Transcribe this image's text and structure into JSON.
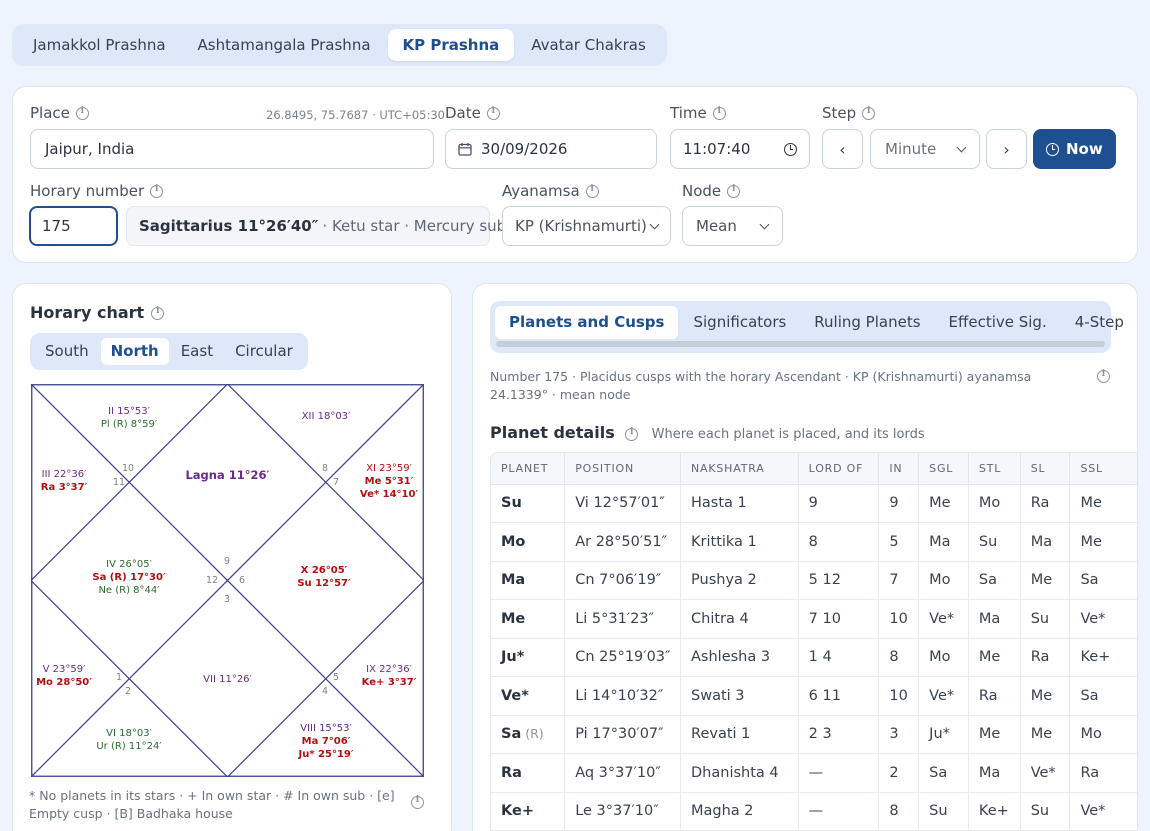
{
  "top_tabs": [
    "Jamakkol Prashna",
    "Ashtamangala Prashna",
    "KP Prashna",
    "Avatar Chakras"
  ],
  "form": {
    "place_label": "Place",
    "place_value": "Jaipur, India",
    "coords": "26.8495, 75.7687 · UTC+05:30",
    "date_label": "Date",
    "date_value": "30/09/2026",
    "time_label": "Time",
    "time_value": "11:07:40",
    "step_label": "Step",
    "step_value": "Minute",
    "prev_btn": "‹",
    "next_btn": "›",
    "now_btn": "Now",
    "horary_label": "Horary number",
    "horary_value": "175",
    "horary_info_main": "Sagittarius 11°26′40″",
    "horary_info_rest": " · Ketu star · Mercury sub",
    "ayanamsa_label": "Ayanamsa",
    "ayanamsa_value": "KP (Krishnamurti)",
    "node_label": "Node",
    "node_value": "Mean"
  },
  "chart": {
    "title": "Horary chart",
    "styles": [
      "South",
      "North",
      "East",
      "Circular"
    ],
    "active_style": "North",
    "houses": {
      "h1": {
        "lines": [
          "Lagna 11°26′"
        ]
      },
      "h2": {
        "lines": [
          "II 15°53′",
          "Pl (R) 8°59′"
        ]
      },
      "h3": {
        "lines": [
          "III 22°36′",
          "Ra 3°37′"
        ]
      },
      "h4": {
        "lines": [
          "IV 26°05′",
          "Sa (R) 17°30′",
          "Ne (R) 8°44′"
        ]
      },
      "h5": {
        "lines": [
          "V 23°59′",
          "Mo 28°50′"
        ]
      },
      "h6": {
        "lines": [
          "VI 18°03′",
          "Ur (R) 11°24′"
        ]
      },
      "h7": {
        "lines": [
          "VII 11°26′"
        ]
      },
      "h8": {
        "lines": [
          "VIII 15°53′",
          "Ma 7°06′",
          "Ju* 25°19′"
        ]
      },
      "h9": {
        "lines": [
          "IX 22°36′",
          "Ke+ 3°37′"
        ]
      },
      "h10": {
        "lines": [
          "X 26°05′",
          "Su 12°57′"
        ]
      },
      "h11": {
        "lines": [
          "XI 23°59′",
          "Me 5°31′",
          "Ve* 14°10′"
        ]
      },
      "h12": {
        "lines": [
          "XII 18°03′"
        ]
      }
    },
    "sign_numbers": [
      "9",
      "10",
      "11",
      "12",
      "1",
      "2",
      "3",
      "4",
      "5",
      "6",
      "7",
      "8"
    ],
    "legend": "* No planets in its stars · + In own star · # In own sub · [e] Empty cusp · [B] Badhaka house"
  },
  "right_tabs": [
    "Planets and Cusps",
    "Significators",
    "Ruling Planets",
    "Effective Sig.",
    "4-Step"
  ],
  "right_desc": "Number 175 · Placidus cusps with the horary Ascendant · KP (Krishnamurti) ayanamsa 24.1339° · mean node",
  "planet_details": {
    "title": "Planet details",
    "subtitle": "Where each planet is placed, and its lords",
    "columns": [
      "PLANET",
      "POSITION",
      "NAKSHATRA",
      "LORD OF",
      "IN",
      "SGL",
      "STL",
      "SL",
      "SSL"
    ],
    "rows": [
      {
        "planet": "Su",
        "retro": "",
        "position": "Vi 12°57′01″",
        "nakshatra": "Hasta 1",
        "lord_of": "9",
        "in": "9",
        "sgl": "Me",
        "stl": "Mo",
        "sl": "Ra",
        "ssl": "Me"
      },
      {
        "planet": "Mo",
        "retro": "",
        "position": "Ar 28°50′51″",
        "nakshatra": "Krittika 1",
        "lord_of": "8",
        "in": "5",
        "sgl": "Ma",
        "stl": "Su",
        "sl": "Ma",
        "ssl": "Me"
      },
      {
        "planet": "Ma",
        "retro": "",
        "position": "Cn 7°06′19″",
        "nakshatra": "Pushya 2",
        "lord_of": "5 12",
        "in": "7",
        "sgl": "Mo",
        "stl": "Sa",
        "sl": "Me",
        "ssl": "Sa"
      },
      {
        "planet": "Me",
        "retro": "",
        "position": "Li 5°31′23″",
        "nakshatra": "Chitra 4",
        "lord_of": "7 10",
        "in": "10",
        "sgl": "Ve*",
        "stl": "Ma",
        "sl": "Su",
        "ssl": "Ve*"
      },
      {
        "planet": "Ju*",
        "retro": "",
        "position": "Cn 25°19′03″",
        "nakshatra": "Ashlesha 3",
        "lord_of": "1 4",
        "in": "8",
        "sgl": "Mo",
        "stl": "Me",
        "sl": "Ra",
        "ssl": "Ke+"
      },
      {
        "planet": "Ve*",
        "retro": "",
        "position": "Li 14°10′32″",
        "nakshatra": "Swati 3",
        "lord_of": "6 11",
        "in": "10",
        "sgl": "Ve*",
        "stl": "Ra",
        "sl": "Me",
        "ssl": "Sa"
      },
      {
        "planet": "Sa",
        "retro": "(R)",
        "position": "Pi 17°30′07″",
        "nakshatra": "Revati 1",
        "lord_of": "2 3",
        "in": "3",
        "sgl": "Ju*",
        "stl": "Me",
        "sl": "Me",
        "ssl": "Mo"
      },
      {
        "planet": "Ra",
        "retro": "",
        "position": "Aq 3°37′10″",
        "nakshatra": "Dhanishta 4",
        "lord_of": "—",
        "in": "2",
        "sgl": "Sa",
        "stl": "Ma",
        "sl": "Ve*",
        "ssl": "Ra"
      },
      {
        "planet": "Ke+",
        "retro": "",
        "position": "Le 3°37′10″",
        "nakshatra": "Magha 2",
        "lord_of": "—",
        "in": "8",
        "sgl": "Su",
        "stl": "Ke+",
        "sl": "Su",
        "ssl": "Ve*"
      }
    ]
  },
  "colors": {
    "accent": "#1d4f91",
    "tab_bg": "#dfe8f8",
    "page_bg": "#eef4fd",
    "chart_line": "#3b3f8f",
    "house_purple": "#6a2a8a",
    "planet_red": "#b01010",
    "planet_green": "#2e6b2e"
  }
}
